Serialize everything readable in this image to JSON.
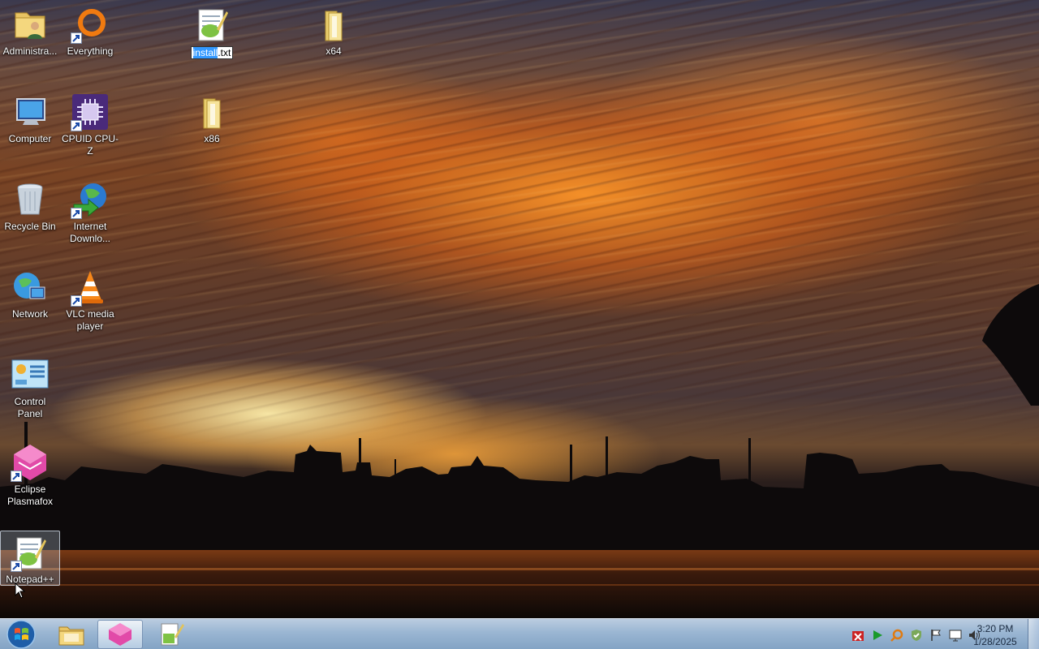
{
  "desktop": {
    "icons": [
      {
        "name": "administrator-folder",
        "label": "Administra..."
      },
      {
        "name": "everything",
        "label": "Everything"
      },
      {
        "name": "install-txt",
        "label_selected": "install",
        "label_rest": ".txt"
      },
      {
        "name": "x64-folder",
        "label": "x64"
      },
      {
        "name": "computer",
        "label": "Computer"
      },
      {
        "name": "cpuid-cpu-z",
        "label": "CPUID CPU-Z"
      },
      {
        "name": "x86-folder",
        "label": "x86"
      },
      {
        "name": "recycle-bin",
        "label": "Recycle Bin"
      },
      {
        "name": "internet-download-manager",
        "label": "Internet Downlo..."
      },
      {
        "name": "network",
        "label": "Network"
      },
      {
        "name": "vlc-media-player",
        "label": "VLC media player"
      },
      {
        "name": "control-panel",
        "label": "Control Panel"
      },
      {
        "name": "eclipse-plasmafox",
        "label": "Eclipse Plasmafox"
      },
      {
        "name": "notepad-plus-plus",
        "label": "Notepad++"
      }
    ]
  },
  "taskbar": {
    "pinned": [
      "start-orb",
      "file-explorer",
      "eclipse-plasmafox",
      "notepad-plus-plus"
    ],
    "tray_icons": [
      "network-error-icon",
      "media-play-icon",
      "search-icon",
      "security-shield-icon",
      "action-center-flag-icon",
      "display-icon",
      "volume-icon"
    ],
    "clock": {
      "time": "3:20 PM",
      "date": "1/28/2025"
    }
  }
}
